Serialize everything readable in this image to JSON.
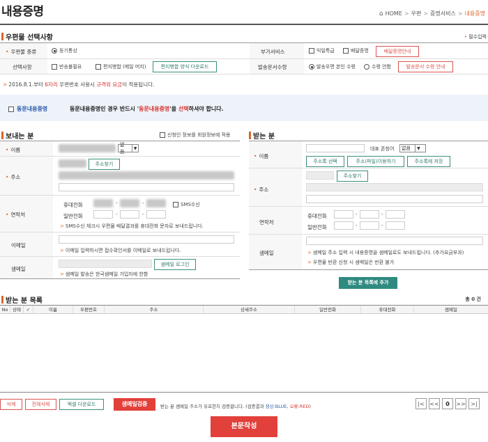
{
  "header": {
    "title": "내용증명",
    "breadcrumb": [
      "HOME",
      "우편",
      "증명서비스",
      "내용증명"
    ],
    "sep": ">"
  },
  "mail_options": {
    "title": "우편물 선택사항",
    "required_note": "필수입력",
    "required_mark": "•",
    "type_label": "우편물 종류",
    "type_value": "등기통상",
    "addon_label": "부가서비스",
    "addon_next_day": "익일특급",
    "addon_delivery_proof": "배달증명",
    "delivery_proof_info_btn": "배달증명안내",
    "selection_label": "선택사항",
    "no_return": "반송불필요",
    "letter_same": "편지병합 (메일 머지)",
    "merge_download_btn": "편지병합 양식 다운로드",
    "return_label": "발송문서수령",
    "return_self": "발송우편 본인 수령",
    "return_none": "수령 안함",
    "return_info_btn": "발송문서 수령 안내"
  },
  "notice": {
    "prefix": "2016.8.1.부터",
    "highlight1": "6자리",
    "middle1": "우편번호 사용시",
    "highlight2": "규격외 요금",
    "suffix": "이 적용됩니다."
  },
  "same_content": {
    "label": "동문내용증명",
    "desc_pre": "동문내용증명인 경우 반드시 '",
    "desc_hl": "동문내용증명",
    "desc_mid": "'을",
    "desc_hl2": "선택",
    "desc_post": "하셔야 합니다."
  },
  "sender": {
    "title": "보내는 분",
    "apply_member": "신청인 정보를 회원정보에 적용",
    "name_label": "이름",
    "name_select": "없음",
    "address_label": "주소",
    "address_btn": "주소찾기",
    "contact_label": "연락처",
    "mobile_label": "휴대전화",
    "phone_label": "일반전화",
    "sms_label": "SMS수신",
    "sms_note": "SMS수신 체크시 우편물 배달결과를 휴대전화 문자로 보내드립니다.",
    "email_label": "이메일",
    "email_note": "이메일 입력하시면 접수확인서를 이메일로 보내드립니다.",
    "samail_label": "샘메일",
    "samail_btn": "샘메일 로그인",
    "samail_note": "샘메일 발송은 한국샘메일 가입자에 한함"
  },
  "receiver": {
    "title": "받는 분",
    "name_label": "이름",
    "rep_label": "대표 존칭어",
    "rep_select": "없음",
    "addr_book_btn": "주소록 선택",
    "file_btn": "주소(파일)이용하기",
    "save_btn": "주소록에 저장",
    "address_label": "주소",
    "address_btn": "주소찾기",
    "contact_label": "연락처",
    "mobile_label": "휴대전화",
    "phone_label": "일반전화",
    "samail_label": "샘메일",
    "samail_note1": "샘메일 주소 입력 시 내용증명을 샘메일로도 보내드립니다. (추가요금부과)",
    "samail_note2": "우편물 반환 신청 시 샘메일은 반환 불가",
    "add_btn": "받는 분 목록에 추가"
  },
  "list": {
    "title": "받는 분 목록",
    "total": "총 0 건",
    "columns": [
      "No",
      "상태",
      "✓",
      "이름",
      "우편번호",
      "주소",
      "상세주소",
      "일반전화",
      "휴대전화",
      "샘메일"
    ]
  },
  "bottom": {
    "delete_btn": "삭제",
    "delete_all_btn": "전체삭제",
    "excel_btn": "엑셀 다운로드",
    "verify_btn": "샘메일검증",
    "verify_note_pre": "받는 분 샘메일 주소가 유효한지 검증합니다. (검증결과 ",
    "verify_ok": "정상:BLUE",
    "verify_sep": ", ",
    "verify_err": "오류:RED",
    "verify_note_post": ")",
    "page_num": "0",
    "write_btn": "본문작성"
  },
  "colors": {
    "accent": "#d9662b",
    "teal": "#2f8a80",
    "red": "#e2403a"
  }
}
